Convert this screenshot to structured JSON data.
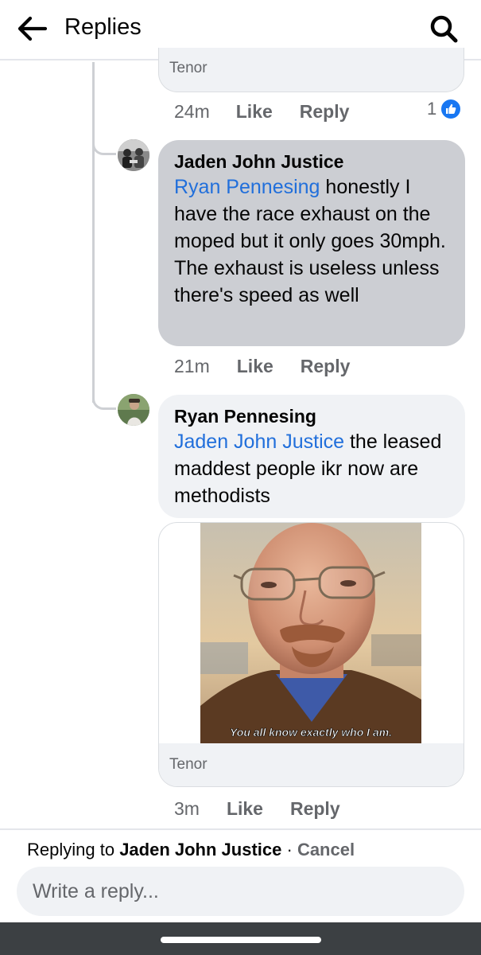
{
  "header": {
    "title": "Replies"
  },
  "previous_comment": {
    "gif_source": "Tenor",
    "time": "24m",
    "like_label": "Like",
    "reply_label": "Reply",
    "reaction_count": "1"
  },
  "comments": [
    {
      "author": "Jaden John Justice",
      "mention": "Ryan Pennesing",
      "text": " honestly I have the race exhaust on the moped but it only goes 30mph. The exhaust is useless unless there's speed as well",
      "time": "21m",
      "like_label": "Like",
      "reply_label": "Reply"
    },
    {
      "author": "Ryan Pennesing",
      "mention": "Jaden John Justice",
      "text": " the leased maddest people ikr now are methodists",
      "gif_caption": "You all know exactly who I am.",
      "gif_source": "Tenor",
      "time": "3m",
      "like_label": "Like",
      "reply_label": "Reply"
    }
  ],
  "reply_bar": {
    "replying_prefix": "Replying to ",
    "replying_to": "Jaden John Justice",
    "separator": " · ",
    "cancel_label": "Cancel",
    "placeholder": "Write a reply..."
  },
  "colors": {
    "mention": "#216fdb",
    "bubble_highlight": "#ccced3",
    "bubble": "#f0f2f5",
    "like_blue": "#1877f2"
  }
}
